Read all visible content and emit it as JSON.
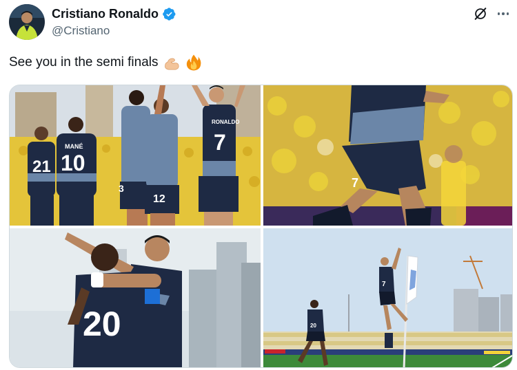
{
  "author": {
    "display_name": "Cristiano Ronaldo",
    "handle": "@Cristiano",
    "verified": true,
    "verified_color": "#1d9bf0"
  },
  "header_actions": {
    "grok_icon": "grok-icon",
    "more_icon": "more-icon"
  },
  "tweet": {
    "text": "See you in the semi finals",
    "emojis": [
      "flexed-biceps-emoji",
      "fire-emoji"
    ]
  },
  "media": {
    "count": 4,
    "photos": [
      {
        "name": "photo-team-celebration",
        "jersey_numbers": [
          "21",
          "10",
          "3",
          "12",
          "7"
        ],
        "jersey_names": [
          "MANÉ",
          "RONALDO"
        ]
      },
      {
        "name": "photo-ronaldo-running",
        "jersey_numbers": [
          "7"
        ]
      },
      {
        "name": "photo-hug-celebration",
        "jersey_numbers": [
          "20"
        ]
      },
      {
        "name": "photo-ronaldo-jump",
        "jersey_numbers": [
          "7",
          "20"
        ]
      }
    ]
  },
  "colors": {
    "kit_navy": "#1e2a44",
    "kit_accent": "#6b86a8",
    "opponent_yellow": "#e8c61e",
    "text_secondary": "#536471"
  }
}
